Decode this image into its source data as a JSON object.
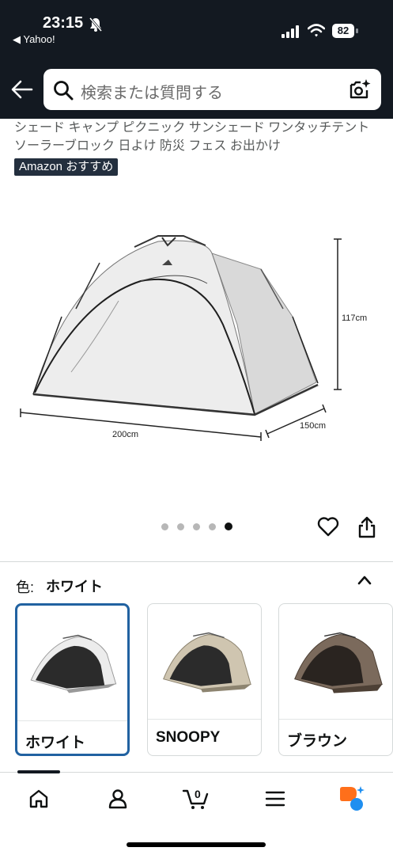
{
  "status_bar": {
    "time": "23:15",
    "back_app": "◀ Yahoo!",
    "battery": "82"
  },
  "search": {
    "placeholder": "検索または質問する"
  },
  "product": {
    "title": "シェード キャンプ ピクニック サンシェード ワンタッチテント ソーラーブロック 日よけ 防災 フェス お出かけ",
    "badge": "Amazon おすすめ",
    "dimensions": {
      "width": "200cm",
      "depth": "150cm",
      "height": "117cm"
    },
    "image_count": 5,
    "active_image_index": 5
  },
  "color_selector": {
    "label": "色:",
    "selected_value": "ホワイト",
    "options": [
      {
        "label": "ホワイト",
        "selected": true
      },
      {
        "label": "SNOOPY",
        "selected": false
      },
      {
        "label": "ブラウン",
        "selected": false
      }
    ]
  },
  "bottom_nav": {
    "items": [
      "home-icon",
      "account-icon",
      "cart-icon",
      "menu-icon",
      "rufus-icon"
    ],
    "cart_count": "0"
  },
  "colors": {
    "header_bg": "#131921",
    "selected_border": "#2162a1",
    "tent_white": "#ececec",
    "tent_beige": "#cfc5b0",
    "tent_brown": "#7b6a5c",
    "rufus_orange": "#ff6f1a",
    "rufus_blue": "#1f8ff0"
  }
}
